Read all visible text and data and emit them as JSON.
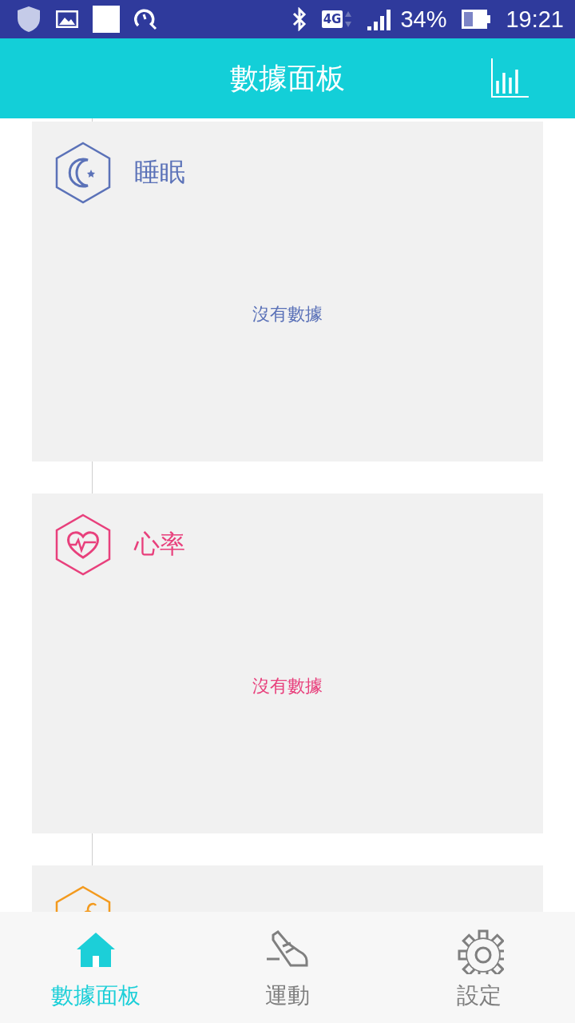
{
  "status_bar": {
    "network": "4G",
    "battery": "34%",
    "time": "19:21"
  },
  "header": {
    "title": "數據面板"
  },
  "cards": [
    {
      "kind": "sleep",
      "color": "#5b72b8",
      "title": "睡眠",
      "message": "沒有數據"
    },
    {
      "kind": "heart",
      "color": "#e8407c",
      "title": "心率",
      "message": "沒有數據"
    },
    {
      "kind": "pressure",
      "color": "#f39a1e"
    }
  ],
  "tabs": [
    {
      "kind": "home",
      "label": "數據面板",
      "selected": true
    },
    {
      "kind": "sport",
      "label": "運動",
      "selected": false
    },
    {
      "kind": "settings",
      "label": "設定",
      "selected": false
    }
  ]
}
